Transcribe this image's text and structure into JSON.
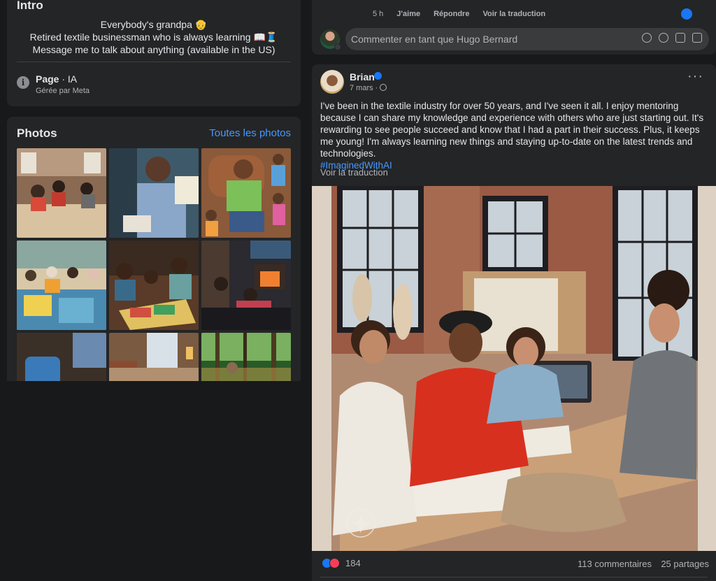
{
  "intro": {
    "title": "Intro",
    "bio_lines": [
      "Everybody's grandpa 👴",
      "Retired textile businessman who is always learning 📖🧵",
      "Message me to talk about anything (available in the US)"
    ],
    "page_label": "Page",
    "page_category": "IA",
    "managed_by": "Gérée par Meta",
    "info_icon": "i"
  },
  "photos": {
    "title": "Photos",
    "see_all": "Toutes les photos",
    "items": [
      {
        "name": "textile-workshop-group"
      },
      {
        "name": "man-at-sewing-machine"
      },
      {
        "name": "grandpa-with-grandchildren"
      },
      {
        "name": "community-quilting"
      },
      {
        "name": "board-game-kids"
      },
      {
        "name": "living-room-fireplace"
      },
      {
        "name": "blue-armchair-room"
      },
      {
        "name": "cozy-lounge"
      },
      {
        "name": "forest-sunlight"
      }
    ]
  },
  "top_comment": {
    "time": "5 h",
    "like": "J'aime",
    "reply": "Répondre",
    "translate": "Voir la traduction",
    "input_placeholder": "Commenter en tant que Hugo Bernard"
  },
  "post": {
    "author": "Brian",
    "date": "7 mars ·",
    "more": "···",
    "text": "I've been in the textile industry for over 50 years, and I've seen it all. I enjoy mentoring because I can share my knowledge and experience with others who are just starting out. It's rewarding to see people succeed and know that I had a part in their success. Plus, it keeps me young! I'm always learning new things and staying up-to-date on the latest trends and technologies.",
    "hashtag": "#ImaginedWithAI",
    "translate": "Voir la traduction",
    "reaction_count": "184",
    "comments": "113 commentaires",
    "shares": "25 partages"
  },
  "colors": {
    "background": "#18191a",
    "card": "#242526",
    "link": "#4599ff",
    "like_blue": "#1877f2",
    "love_red": "#f33e58"
  }
}
